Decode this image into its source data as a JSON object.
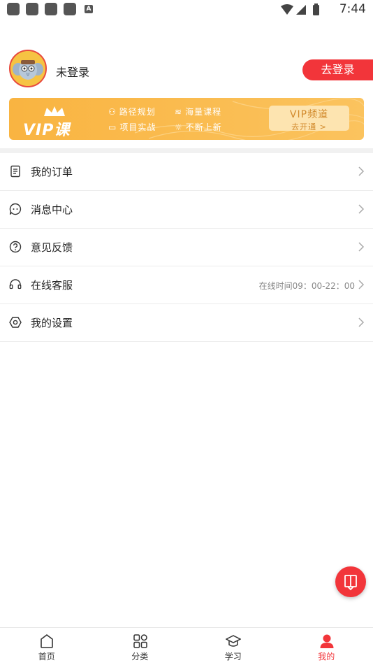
{
  "status_bar": {
    "time": "7:44",
    "notif_a": "A"
  },
  "profile": {
    "username": "未登录",
    "login_label": "去登录"
  },
  "vip": {
    "logo": "VIP课",
    "features": [
      "路径规划",
      "海量课程",
      "项目实战",
      "不断上新"
    ],
    "channel_title": "VIP频道",
    "channel_sub": "去开通 >"
  },
  "menu": {
    "items": [
      {
        "label": "我的订单",
        "icon": "document-icon"
      },
      {
        "label": "消息中心",
        "icon": "message-icon"
      },
      {
        "label": "意见反馈",
        "icon": "question-icon"
      },
      {
        "label": "在线客服",
        "icon": "headset-icon",
        "extra": "在线时间09：00-22：00"
      },
      {
        "label": "我的设置",
        "icon": "settings-icon"
      }
    ]
  },
  "tabbar": {
    "tabs": [
      {
        "label": "首页",
        "icon": "home-icon"
      },
      {
        "label": "分类",
        "icon": "grid-icon"
      },
      {
        "label": "学习",
        "icon": "graduation-cap-icon"
      },
      {
        "label": "我的",
        "icon": "user-icon",
        "active": true
      }
    ]
  },
  "colors": {
    "accent": "#f2353a",
    "vip_gold": "#f9b441"
  }
}
